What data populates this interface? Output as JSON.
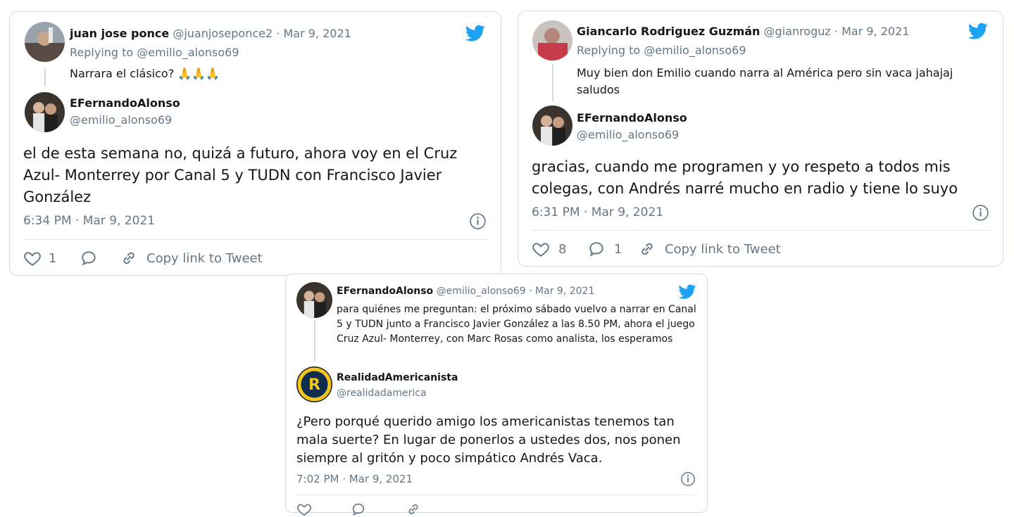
{
  "card1": {
    "parent": {
      "name": "juan jose ponce",
      "handle": "@juanjoseponce2",
      "sep": "·",
      "date": "Mar 9, 2021",
      "replying": "Replying to @emilio_alonso69",
      "text": "Narrara el clásico? 🙏🙏🙏"
    },
    "reply": {
      "name": "EFernandoAlonso",
      "handle": "@emilio_alonso69",
      "text": "el de esta semana no, quizá a futuro, ahora voy en el Cruz Azul- Monterrey por Canal 5 y TUDN con Francisco Javier González",
      "timestamp": "6:34 PM · Mar 9, 2021"
    },
    "actions": {
      "likes": "1",
      "copy_link": "Copy link to Tweet"
    }
  },
  "card2": {
    "parent": {
      "name": "Giancarlo Rodriguez Guzmán",
      "handle": "@gianroguz",
      "sep": "·",
      "date": "Mar 9, 2021",
      "replying": "Replying to @emilio_alonso69",
      "text": "Muy bien don Emilio cuando narra al América pero sin vaca jahajaj saludos"
    },
    "reply": {
      "name": "EFernandoAlonso",
      "handle": "@emilio_alonso69",
      "text": "gracias, cuando me programen y yo respeto a todos mis colegas, con Andrés narré mucho en radio y tiene lo suyo",
      "timestamp": "6:31 PM · Mar 9, 2021"
    },
    "actions": {
      "likes": "8",
      "replies": "1",
      "copy_link": "Copy link to Tweet"
    }
  },
  "card3": {
    "parent": {
      "name": "EFernandoAlonso",
      "handle": "@emilio_alonso69",
      "sep": "·",
      "date": "Mar 9, 2021",
      "text": "para quiénes me preguntan: el próximo sábado vuelvo a narrar en Canal 5 y TUDN junto a Francisco Javier González  a las 8.50 PM, ahora el juego Cruz Azul- Monterrey, con Marc Rosas como analista, los esperamos"
    },
    "reply": {
      "name": "RealidadAmericanista",
      "handle": "@realidadamerica",
      "text": "¿Pero porqué querido amigo los americanistas tenemos tan mala suerte? En lugar de ponerlos a ustedes dos, nos ponen siempre al gritón y poco simpático Andrés Vaca.",
      "timestamp": "7:02 PM · Mar 9, 2021"
    }
  },
  "colors": {
    "twitter_blue": "#1da1f2",
    "muted_text": "#657786",
    "border": "#d3dbe2"
  },
  "icons": [
    "twitter-bird-icon",
    "heart-icon",
    "reply-icon",
    "link-icon",
    "info-icon"
  ]
}
